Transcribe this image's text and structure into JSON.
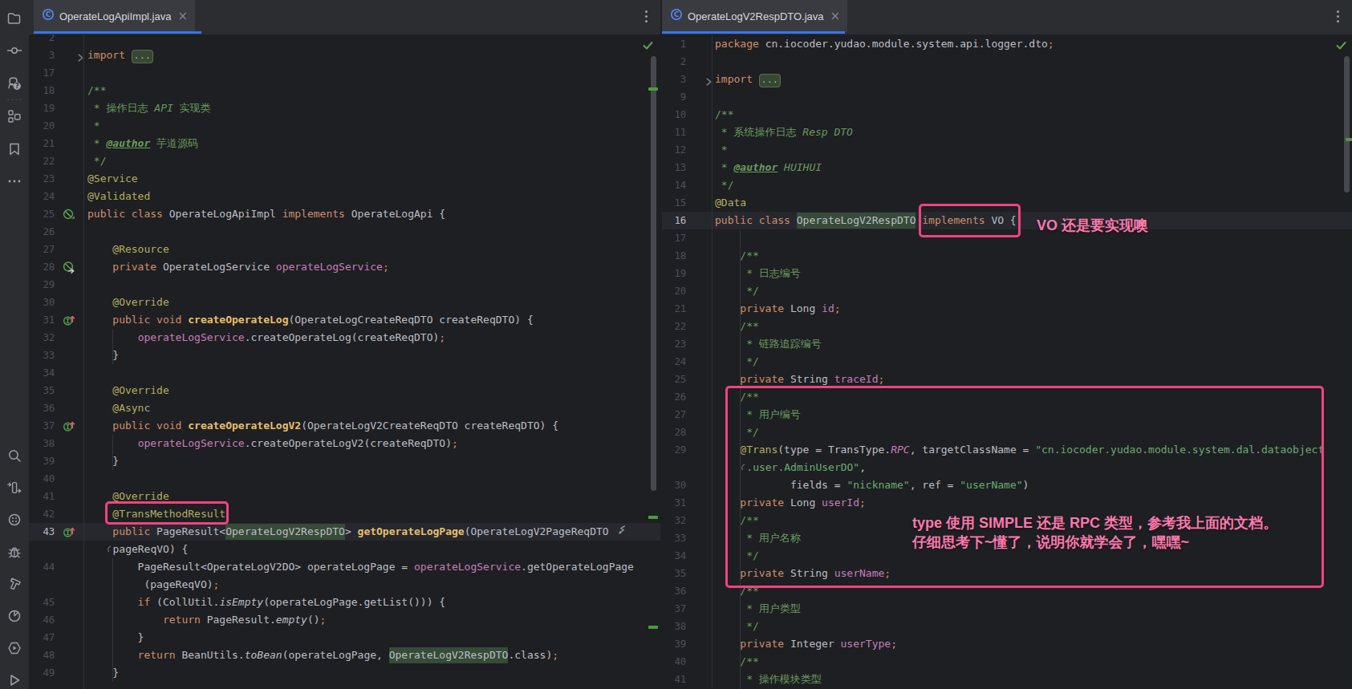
{
  "colors": {
    "editor_bg": "#1e1f22",
    "panel_bg": "#2b2d30",
    "active_tab_bg": "#393b40",
    "accent_blue": "#3574f0",
    "caret_row": "#26282e",
    "annotation_pink": "#f0437f",
    "pink_text": "#fb79ad",
    "keyword": "#cf8e6d",
    "annotation": "#b3ae60",
    "doc_comment": "#6a9a5e",
    "string": "#6aab73",
    "field": "#c77dbb",
    "method_decl": "#e8bf6a",
    "plain": "#bcbec4",
    "usage_highlight_bg": "#364b38",
    "vcs_added": "#4e9b40",
    "line_number": "#4b5059"
  },
  "activity_bar": {
    "top_icons": [
      {
        "name": "project-icon"
      },
      {
        "name": "commit-icon"
      },
      {
        "name": "learn-assistant-icon"
      },
      {
        "name": "structure-icon"
      },
      {
        "name": "bookmarks-icon"
      },
      {
        "name": "more-tool-windows-icon"
      }
    ],
    "bottom_icons": [
      {
        "name": "search-icon"
      },
      {
        "name": "dependencies-icon"
      },
      {
        "name": "problems-icon"
      },
      {
        "name": "debug-icon"
      },
      {
        "name": "build-icon"
      },
      {
        "name": "profiler-icon"
      },
      {
        "name": "services-icon"
      },
      {
        "name": "run-icon"
      }
    ]
  },
  "left_pane": {
    "tab": {
      "title": "OperateLogApiImpl.java",
      "icon": "java-class-icon",
      "close_label": "×"
    },
    "rows": [
      {
        "n": "2",
        "t": []
      },
      {
        "n": "3",
        "fold": true,
        "t": [
          [
            "k",
            "import "
          ],
          [
            "badge",
            "..."
          ]
        ]
      },
      {
        "n": "17",
        "t": []
      },
      {
        "n": "18",
        "t": [
          [
            "d",
            "/**"
          ]
        ]
      },
      {
        "n": "19",
        "t": [
          [
            "d",
            " * 操作日志 "
          ],
          [
            "di",
            "API"
          ],
          [
            "d",
            " 实现类"
          ]
        ]
      },
      {
        "n": "20",
        "t": [
          [
            "d",
            " *"
          ]
        ]
      },
      {
        "n": "21",
        "t": [
          [
            "d",
            " * "
          ],
          [
            "dt",
            "@author"
          ],
          [
            "d",
            " 芋道源码"
          ]
        ]
      },
      {
        "n": "22",
        "t": [
          [
            "d",
            " */"
          ]
        ]
      },
      {
        "n": "23",
        "t": [
          [
            "an",
            "@Service"
          ]
        ]
      },
      {
        "n": "24",
        "t": [
          [
            "an",
            "@Validated"
          ]
        ]
      },
      {
        "n": "25",
        "icon": "bean",
        "t": [
          [
            "k",
            "public class "
          ],
          [
            "p",
            "OperateLogApiImpl "
          ],
          [
            "k",
            "implements "
          ],
          [
            "p",
            "OperateLogApi {"
          ]
        ]
      },
      {
        "n": "26",
        "t": []
      },
      {
        "n": "27",
        "t": [
          [
            "an",
            "    @Resource"
          ]
        ]
      },
      {
        "n": "28",
        "icon": "autowired",
        "t": [
          [
            "k",
            "    private "
          ],
          [
            "p",
            "OperateLogService "
          ],
          [
            "f",
            "operateLogService"
          ],
          [
            "k",
            ";"
          ]
        ]
      },
      {
        "n": "29",
        "t": []
      },
      {
        "n": "30",
        "t": [
          [
            "an",
            "    @Override"
          ]
        ]
      },
      {
        "n": "31",
        "icon": "override",
        "t": [
          [
            "k",
            "    public void "
          ],
          [
            "m",
            "createOperateLog"
          ],
          [
            "p",
            "(OperateLogCreateReqDTO createReqDTO) {"
          ]
        ]
      },
      {
        "n": "32",
        "t": [
          [
            "p",
            "        "
          ],
          [
            "f",
            "operateLogService"
          ],
          [
            "p",
            ".createOperateLog(createReqDTO)"
          ],
          [
            "k",
            ";"
          ]
        ]
      },
      {
        "n": "33",
        "t": [
          [
            "p",
            "    }"
          ]
        ]
      },
      {
        "n": "34",
        "t": []
      },
      {
        "n": "35",
        "t": [
          [
            "an",
            "    @Override"
          ]
        ]
      },
      {
        "n": "36",
        "t": [
          [
            "an",
            "    @Async"
          ]
        ]
      },
      {
        "n": "37",
        "icon": "override",
        "t": [
          [
            "k",
            "    public void "
          ],
          [
            "m",
            "createOperateLogV2"
          ],
          [
            "p",
            "(OperateLogV2CreateReqDTO createReqDTO) {"
          ]
        ]
      },
      {
        "n": "38",
        "t": [
          [
            "p",
            "        "
          ],
          [
            "f",
            "operateLogService"
          ],
          [
            "p",
            ".createOperateLogV2(createReqDTO)"
          ],
          [
            "k",
            ";"
          ]
        ]
      },
      {
        "n": "39",
        "t": [
          [
            "p",
            "    }"
          ]
        ]
      },
      {
        "n": "40",
        "t": []
      },
      {
        "n": "41",
        "t": [
          [
            "an",
            "    @Override"
          ]
        ]
      },
      {
        "n": "42",
        "t": [
          [
            "an",
            "    @TransMethodResult"
          ]
        ]
      },
      {
        "n": "43",
        "icon": "override",
        "caret": true,
        "t": [
          [
            "k",
            "    public "
          ],
          [
            "p",
            "PageResult<"
          ],
          [
            "hl",
            "OperateLogV2RespDTO"
          ],
          [
            "p",
            "> "
          ],
          [
            "m",
            "getOperateLogPage"
          ],
          [
            "p",
            "(OperateLogV2PageReqDTO "
          ],
          [
            "weol",
            ""
          ]
        ]
      },
      {
        "n": "",
        "t": [
          [
            "p",
            "   "
          ],
          [
            "wstart",
            ""
          ],
          [
            "p",
            "pageReqVO) {"
          ]
        ]
      },
      {
        "n": "44",
        "t": [
          [
            "p",
            "        PageResult<OperateLogV2DO> operateLogPage = "
          ],
          [
            "f",
            "operateLogService"
          ],
          [
            "p",
            ".getOperateLogPage"
          ]
        ]
      },
      {
        "n": "",
        "t": [
          [
            "p",
            "         "
          ],
          [
            "p",
            "(pageReqVO)"
          ],
          [
            "k",
            ";"
          ]
        ]
      },
      {
        "n": "45",
        "t": [
          [
            "k",
            "        if "
          ],
          [
            "p",
            "(CollUtil."
          ],
          [
            "sm",
            "isEmpty"
          ],
          [
            "p",
            "(operateLogPage.getList())) {"
          ]
        ]
      },
      {
        "n": "46",
        "t": [
          [
            "k",
            "            return "
          ],
          [
            "p",
            "PageResult."
          ],
          [
            "sm",
            "empty"
          ],
          [
            "p",
            "()"
          ],
          [
            "k",
            ";"
          ]
        ]
      },
      {
        "n": "47",
        "t": [
          [
            "p",
            "        }"
          ]
        ]
      },
      {
        "n": "48",
        "t": [
          [
            "k",
            "        return "
          ],
          [
            "p",
            "BeanUtils."
          ],
          [
            "sm",
            "toBean"
          ],
          [
            "p",
            "(operateLogPage, "
          ],
          [
            "hl",
            "OperateLogV2RespDTO"
          ],
          [
            "p",
            ".class)"
          ],
          [
            "k",
            ";"
          ]
        ]
      },
      {
        "n": "49",
        "t": [
          [
            "p",
            "    }"
          ]
        ]
      }
    ]
  },
  "right_pane": {
    "tab": {
      "title": "OperateLogV2RespDTO.java",
      "icon": "java-class-icon",
      "close_label": "×"
    },
    "rows": [
      {
        "n": "1",
        "t": [
          [
            "k",
            "package "
          ],
          [
            "p",
            "cn.iocoder.yudao.module.system.api.logger.dto"
          ],
          [
            "k",
            ";"
          ]
        ]
      },
      {
        "n": "2",
        "t": []
      },
      {
        "n": "3",
        "fold": true,
        "t": [
          [
            "k",
            "import "
          ],
          [
            "badge",
            "..."
          ]
        ]
      },
      {
        "n": "9",
        "t": []
      },
      {
        "n": "10",
        "t": [
          [
            "d",
            "/**"
          ]
        ]
      },
      {
        "n": "11",
        "t": [
          [
            "d",
            " * 系统操作日志 "
          ],
          [
            "di",
            "Resp DTO"
          ]
        ]
      },
      {
        "n": "12",
        "t": [
          [
            "d",
            " *"
          ]
        ]
      },
      {
        "n": "13",
        "t": [
          [
            "d",
            " * "
          ],
          [
            "dt",
            "@author"
          ],
          [
            "di",
            " HUIHUI"
          ]
        ]
      },
      {
        "n": "14",
        "t": [
          [
            "d",
            " */"
          ]
        ]
      },
      {
        "n": "15",
        "t": [
          [
            "an",
            "@Data"
          ]
        ]
      },
      {
        "n": "16",
        "caret": true,
        "t": [
          [
            "k",
            "public class "
          ],
          [
            "hl",
            "OperateLogV2RespDTO"
          ],
          [
            "p",
            " "
          ],
          [
            "k",
            "implements "
          ],
          [
            "p",
            "VO {"
          ]
        ]
      },
      {
        "n": "17",
        "t": []
      },
      {
        "n": "18",
        "t": [
          [
            "d",
            "    /**"
          ]
        ]
      },
      {
        "n": "19",
        "t": [
          [
            "d",
            "     * 日志编号"
          ]
        ]
      },
      {
        "n": "20",
        "t": [
          [
            "d",
            "     */"
          ]
        ]
      },
      {
        "n": "21",
        "t": [
          [
            "k",
            "    private "
          ],
          [
            "p",
            "Long "
          ],
          [
            "f",
            "id"
          ],
          [
            "k",
            ";"
          ]
        ]
      },
      {
        "n": "22",
        "t": [
          [
            "d",
            "    /**"
          ]
        ]
      },
      {
        "n": "23",
        "t": [
          [
            "d",
            "     * 链路追踪编号"
          ]
        ]
      },
      {
        "n": "24",
        "t": [
          [
            "d",
            "     */"
          ]
        ]
      },
      {
        "n": "25",
        "t": [
          [
            "k",
            "    private "
          ],
          [
            "p",
            "String "
          ],
          [
            "f",
            "traceId"
          ],
          [
            "k",
            ";"
          ]
        ]
      },
      {
        "n": "26",
        "t": [
          [
            "d",
            "    /**"
          ]
        ]
      },
      {
        "n": "27",
        "t": [
          [
            "d",
            "     * 用户编号"
          ]
        ]
      },
      {
        "n": "28",
        "t": [
          [
            "d",
            "     */"
          ]
        ]
      },
      {
        "n": "29",
        "t": [
          [
            "an",
            "    @Trans"
          ],
          [
            "p",
            "(type = TransType."
          ],
          [
            "c",
            "RPC"
          ],
          [
            "p",
            ", targetClassName = "
          ],
          [
            "s",
            "\"cn.iocoder.yudao.module.system.dal.dataobject"
          ]
        ]
      },
      {
        "n": "",
        "t": [
          [
            "p",
            "    "
          ],
          [
            "wstart",
            ""
          ],
          [
            "s",
            ".user.AdminUserDO\""
          ],
          [
            "p",
            ","
          ]
        ]
      },
      {
        "n": "30",
        "t": [
          [
            "p",
            "            fields = "
          ],
          [
            "s",
            "\"nickname\""
          ],
          [
            "p",
            ", ref = "
          ],
          [
            "s",
            "\"userName\""
          ],
          [
            "p",
            ")"
          ]
        ]
      },
      {
        "n": "31",
        "t": [
          [
            "k",
            "    private "
          ],
          [
            "p",
            "Long "
          ],
          [
            "f",
            "userId"
          ],
          [
            "k",
            ";"
          ]
        ]
      },
      {
        "n": "32",
        "t": [
          [
            "d",
            "    /**"
          ]
        ]
      },
      {
        "n": "33",
        "t": [
          [
            "d",
            "     * 用户名称"
          ]
        ]
      },
      {
        "n": "34",
        "t": [
          [
            "d",
            "     */"
          ]
        ]
      },
      {
        "n": "35",
        "t": [
          [
            "k",
            "    private "
          ],
          [
            "p",
            "String "
          ],
          [
            "f",
            "userName"
          ],
          [
            "k",
            ";"
          ]
        ]
      },
      {
        "n": "36",
        "t": [
          [
            "d",
            "    /**"
          ]
        ]
      },
      {
        "n": "37",
        "t": [
          [
            "d",
            "     * 用户类型"
          ]
        ]
      },
      {
        "n": "38",
        "t": [
          [
            "d",
            "     */"
          ]
        ]
      },
      {
        "n": "39",
        "t": [
          [
            "k",
            "    private "
          ],
          [
            "p",
            "Integer "
          ],
          [
            "f",
            "userType"
          ],
          [
            "k",
            ";"
          ]
        ]
      },
      {
        "n": "40",
        "t": [
          [
            "d",
            "    /**"
          ]
        ]
      },
      {
        "n": "41",
        "t": [
          [
            "d",
            "     * 操作模块类型"
          ]
        ]
      }
    ]
  },
  "annotations": {
    "vo_note": "VO 还是要实现噢",
    "type_note_line1": "type 使用 SIMPLE 还是 RPC 类型，参考我上面的文档。",
    "type_note_line2": "仔细思考下~懂了，说明你就学会了，嘿嘿~"
  }
}
